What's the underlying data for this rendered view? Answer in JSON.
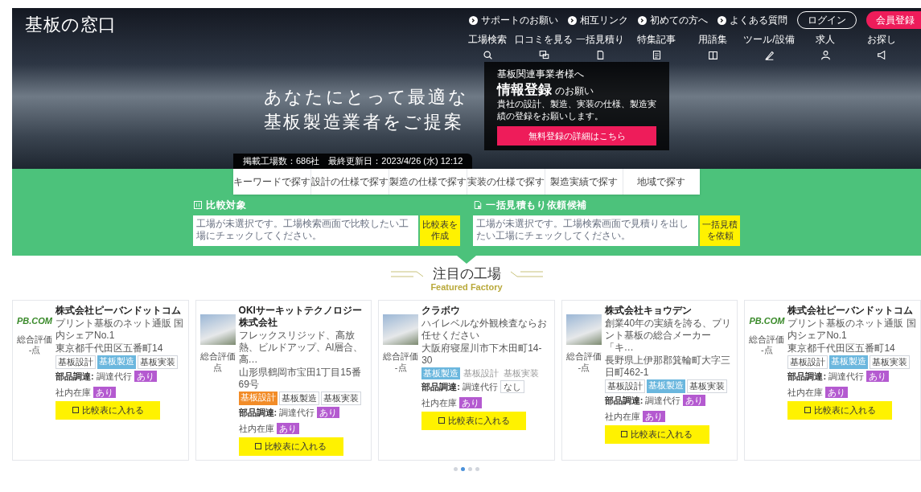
{
  "header": {
    "logo": "基板の窓口",
    "top_links": [
      {
        "label": "サポートのお願い"
      },
      {
        "label": "相互リンク"
      },
      {
        "label": "初めての方へ"
      },
      {
        "label": "よくある質問"
      }
    ],
    "login_button": "ログイン",
    "register_button": "会員登録",
    "nav": [
      {
        "label": "工場検索"
      },
      {
        "label": "口コミを見る"
      },
      {
        "label": "一括見積り"
      },
      {
        "label": "特集記事"
      },
      {
        "label": "用語集"
      },
      {
        "label": "ツール/設備"
      },
      {
        "label": "求人"
      },
      {
        "label": "お探し"
      }
    ]
  },
  "hero": {
    "headline": [
      "あなたにとって最適な",
      "基板製造業者をご提案"
    ],
    "notice": {
      "lead": "基板関連事業者様へ",
      "title": "情報登録",
      "title_suffix": "のお願い",
      "text": "貴社の設計、製造、実装の仕様、製造実績の登録をお願いします。",
      "button": "無料登録の詳細はこちら"
    },
    "stats": "掲載工場数：686社　最終更新日：2023/4/26 (水) 12:12"
  },
  "search_tabs": [
    "キーワードで探す",
    "設計の仕様で探す",
    "製造の仕様で探す",
    "実装の仕様で探す",
    "製造実績で探す",
    "地域で探す"
  ],
  "panels": [
    {
      "title": "比較対象",
      "placeholder": "工場が未選択です。工場検索画面で比較したい工場にチェックしてください。",
      "button": "比較表を作成"
    },
    {
      "title": "一括見積もり依頼候補",
      "placeholder": "工場が未選択です。工場検索画面で見積りを出したい工場にチェックしてください。",
      "button": "一括見積を依頼"
    }
  ],
  "featured": {
    "title": "注目の工場",
    "subtitle": "Featured Factory",
    "cards": [
      {
        "image": {
          "kind": "logo",
          "text": "PB.COM"
        },
        "name": "株式会社ピーバンドットコム",
        "description": "プリント基板のネット通販 国内シェアNo.1",
        "address": "東京都千代田区五番町14",
        "rating_label": "総合評価",
        "rating_value": "-点",
        "tags": [
          {
            "label": "基板設計",
            "kind": "plain"
          },
          {
            "label": "基板製造",
            "kind": "highlight",
            "color": "#6bb7de"
          },
          {
            "label": "基板実装",
            "kind": "plain"
          }
        ],
        "parts_label": "部品調達:",
        "parts": [
          {
            "label": "調達代行",
            "value": "あり",
            "available": true
          },
          {
            "label": "社内在庫",
            "value": "あり",
            "available": true
          }
        ],
        "button": "比較表に入れる"
      },
      {
        "image": {
          "kind": "photo"
        },
        "name": "OKIサーキットテクノロジー株式会社",
        "description": "フレックスリジッド、高放熱、ビルドアップ、Al層合、高…",
        "address": "山形県鶴岡市宝田1丁目15番69号",
        "rating_label": "総合評価",
        "rating_value": "点",
        "tags": [
          {
            "label": "基板設計",
            "kind": "highlight",
            "color": "#f28c28"
          },
          {
            "label": "基板製造",
            "kind": "plain"
          },
          {
            "label": "基板実装",
            "kind": "plain"
          }
        ],
        "parts_label": "部品調達:",
        "parts": [
          {
            "label": "調達代行",
            "value": "あり",
            "available": true
          },
          {
            "label": "社内在庫",
            "value": "あり",
            "available": true
          }
        ],
        "button": "比較表に入れる"
      },
      {
        "image": {
          "kind": "photo"
        },
        "name": "クラボウ",
        "description": "ハイレベルな外観検査ならお任せください",
        "address": "大阪府寝屋川市下木田町14-30",
        "rating_label": "総合評価",
        "rating_value": "-点",
        "tags": [
          {
            "label": "基板製造",
            "kind": "highlight",
            "color": "#6bb7de"
          },
          {
            "label": "基板設計",
            "kind": "muted"
          },
          {
            "label": "基板実装",
            "kind": "muted"
          }
        ],
        "parts_label": "部品調達:",
        "parts": [
          {
            "label": "調達代行",
            "value": "なし",
            "available": false
          },
          {
            "label": "社内在庫",
            "value": "あり",
            "available": true
          }
        ],
        "button": "比較表に入れる"
      },
      {
        "image": {
          "kind": "photo"
        },
        "name": "株式会社キョウデン",
        "description": "創業40年の実績を誇る、プリント基板の総合メーカー「キ…",
        "address": "長野県上伊那郡箕輪町大字三日町462-1",
        "rating_label": "総合評価",
        "rating_value": "-点",
        "tags": [
          {
            "label": "基板設計",
            "kind": "plain"
          },
          {
            "label": "基板製造",
            "kind": "highlight",
            "color": "#6bb7de"
          },
          {
            "label": "基板実装",
            "kind": "plain"
          }
        ],
        "parts_label": "部品調達:",
        "parts": [
          {
            "label": "調達代行",
            "value": "あり",
            "available": true
          },
          {
            "label": "社内在庫",
            "value": "あり",
            "available": true
          }
        ],
        "button": "比較表に入れる"
      },
      {
        "image": {
          "kind": "logo",
          "text": "PB.COM"
        },
        "name": "株式会社ピーバンドットコム",
        "description": "プリント基板のネット通販 国内シェアNo.1",
        "address": "東京都千代田区五番町14",
        "rating_label": "総合評価",
        "rating_value": "-点",
        "tags": [
          {
            "label": "基板設計",
            "kind": "plain"
          },
          {
            "label": "基板製造",
            "kind": "highlight",
            "color": "#6bb7de"
          },
          {
            "label": "基板実装",
            "kind": "plain"
          }
        ],
        "parts_label": "部品調達:",
        "parts": [
          {
            "label": "調達代行",
            "value": "あり",
            "available": true
          },
          {
            "label": "社内在庫",
            "value": "あり",
            "available": true
          }
        ],
        "button": "比較表に入れる"
      }
    ],
    "carousel_dots": [
      {
        "selected": false
      },
      {
        "selected": true
      },
      {
        "selected": false
      },
      {
        "selected": false
      }
    ]
  }
}
